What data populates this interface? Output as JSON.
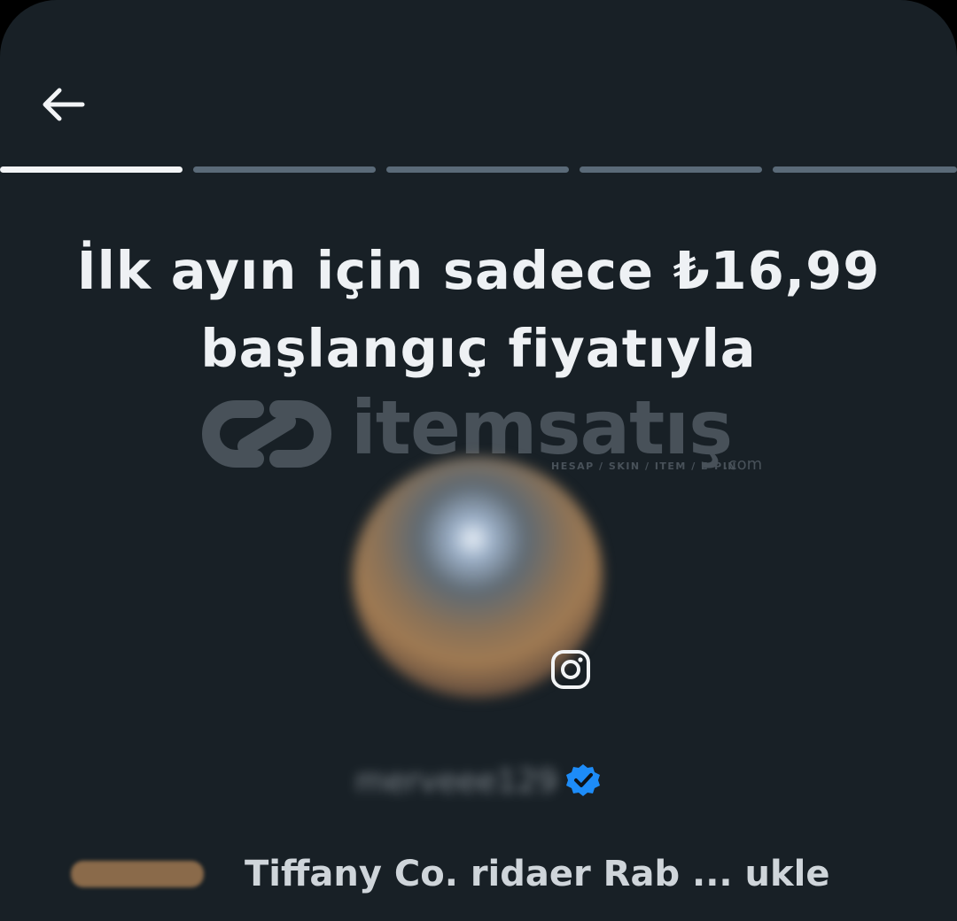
{
  "header": {
    "back_icon": "arrow-left-icon"
  },
  "progress": {
    "total_steps": 5,
    "current_step": 1
  },
  "offer": {
    "title_line1": "İlk ayın için sadece ₺16,99",
    "title_line2": "başlangıç fiyatıyla"
  },
  "watermark": {
    "brand": "itemsatış",
    "subtitle": "HESAP / SKIN / ITEM / E-PIN",
    "suffix": ".com"
  },
  "profile": {
    "avatar_icon": "profile-avatar",
    "platform_icon": "instagram-icon",
    "username": "merveee129",
    "verified_icon": "verified-badge-icon"
  },
  "bottom": {
    "text": "Tiffany Co. ridaer Rab ... ukle"
  },
  "colors": {
    "background": "#182026",
    "progress_active": "#f2f4f6",
    "progress_inactive": "#5a6a78",
    "verified": "#1d8cf8",
    "text": "#eef1f4"
  }
}
